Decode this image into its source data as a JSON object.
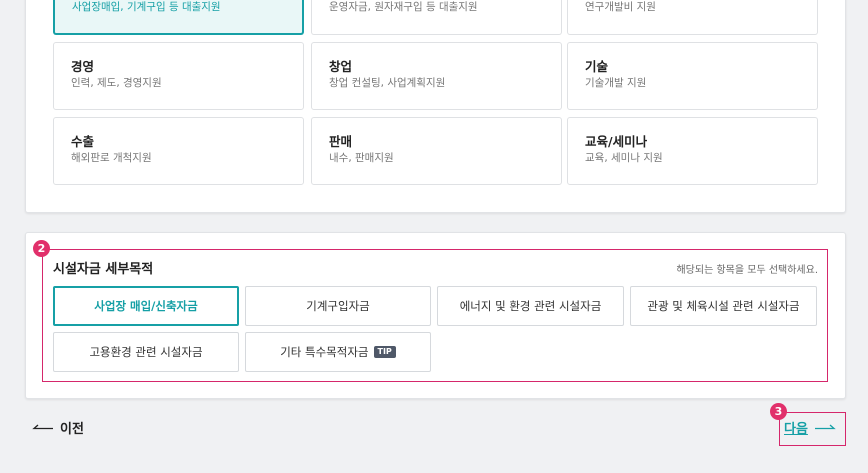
{
  "categories": [
    {
      "title": "",
      "desc": "사업장매입, 기계구입 등 대출지원",
      "active": true
    },
    {
      "title": "",
      "desc": "운영자금, 원자재구입 등 대출지원",
      "active": false
    },
    {
      "title": "",
      "desc": "연구개발비 지원",
      "active": false
    },
    {
      "title": "경영",
      "desc": "인력, 제도, 경영지원",
      "active": false
    },
    {
      "title": "창업",
      "desc": "창업 컨설팅, 사업계획지원",
      "active": false
    },
    {
      "title": "기술",
      "desc": "기술개발 지원",
      "active": false
    },
    {
      "title": "수출",
      "desc": "해외판로 개척지원",
      "active": false
    },
    {
      "title": "판매",
      "desc": "내수, 판매지원",
      "active": false
    },
    {
      "title": "교육/세미나",
      "desc": "교육, 세미나 지원",
      "active": false
    }
  ],
  "section": {
    "badge": "2",
    "title": "시설자금 세부목적",
    "hint": "해당되는 항목을 모두 선택하세요.",
    "options": [
      {
        "label": "사업장 매입/신축자금",
        "active": true
      },
      {
        "label": "기계구입자금",
        "active": false
      },
      {
        "label": "에너지 및 환경 관련 시설자금",
        "active": false
      },
      {
        "label": "관광 및 체육시설 관련 시설자금",
        "active": false
      },
      {
        "label": "고용환경 관련 시설자금",
        "active": false
      },
      {
        "label": "기타 특수목적자금",
        "active": false,
        "tip": "TIP"
      }
    ]
  },
  "nav": {
    "prev_label": "이전",
    "next_label": "다음",
    "next_badge": "3"
  },
  "colors": {
    "accent": "#16a0a6",
    "highlight": "#e1306b"
  }
}
